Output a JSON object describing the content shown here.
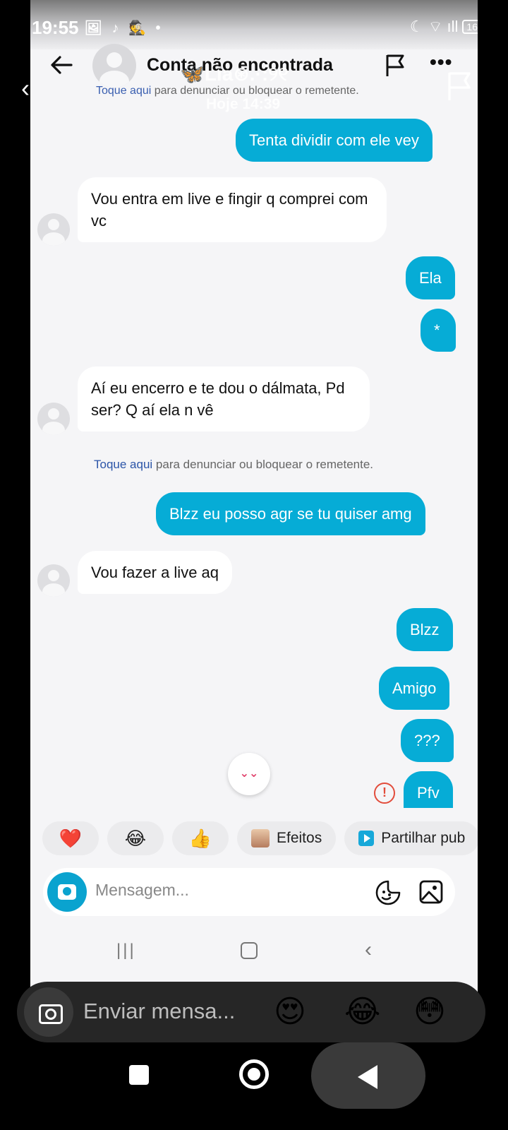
{
  "status_bar": {
    "time_front": "19:55",
    "time_back": "14:39",
    "battery": "16"
  },
  "chat_header": {
    "title": "Conta não encontrada"
  },
  "story_overlay": {
    "name": "🦋Lia⊛.·:୨୧",
    "time": "Hoje 14:39"
  },
  "report_notice": {
    "link": "Toque aqui",
    "text": " para denunciar ou bloquear o remetente."
  },
  "messages": [
    {
      "id": "m1",
      "direction": "out",
      "text": "Tenta dividir com ele vey"
    },
    {
      "id": "m2",
      "direction": "in",
      "text": "Vou entra em live e fingir q comprei com vc"
    },
    {
      "id": "m3",
      "direction": "out",
      "text": "Ela"
    },
    {
      "id": "m4",
      "direction": "out",
      "text": "*"
    },
    {
      "id": "m5",
      "direction": "in",
      "text": "Aí eu encerro e te dou o dálmata, Pd ser? Q aí ela n vê"
    },
    {
      "id": "m6",
      "direction": "out",
      "text": "Blzz eu posso agr se tu quiser amg"
    },
    {
      "id": "m7",
      "direction": "in",
      "text": "Vou fazer a live aq"
    },
    {
      "id": "m8",
      "direction": "out",
      "text": "Blzz"
    },
    {
      "id": "m9",
      "direction": "out",
      "text": "Amigo"
    },
    {
      "id": "m10",
      "direction": "out",
      "text": "???"
    },
    {
      "id": "m11",
      "direction": "out",
      "text": "Pfv",
      "status": "error"
    }
  ],
  "quick_replies": {
    "heart": "❤️",
    "laugh": "😂",
    "thumbs_up": "👍",
    "effects": "Efeitos",
    "share": "Partilhar pub"
  },
  "composer": {
    "placeholder": "Mensagem..."
  },
  "story_reply": {
    "placeholder": "Enviar mensa...",
    "emojis": [
      "😍",
      "😂",
      "😳"
    ]
  },
  "colors": {
    "outgoing_bubble": "#06acd6",
    "incoming_bubble": "#ffffff",
    "chat_background": "#f5f5f7",
    "error": "#e24c3b"
  },
  "icons": {
    "back": "arrow-left-icon",
    "report": "flag-icon",
    "more": "more-horizontal-icon",
    "scroll": "chevron-double-down-icon",
    "error": "alert-circle-icon",
    "camera": "camera-icon",
    "sticker": "sticker-icon",
    "gallery": "image-icon"
  }
}
